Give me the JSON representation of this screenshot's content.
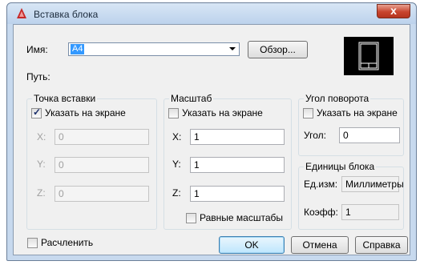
{
  "window": {
    "title": "Вставка блока",
    "close_symbol": "x"
  },
  "name_row": {
    "label": "Имя:",
    "value": "A4",
    "browse_label": "Обзор..."
  },
  "path": {
    "label": "Путь:"
  },
  "insertion_point": {
    "title": "Точка вставки",
    "specify_on_screen": {
      "label": "Указать на экране",
      "checked": true
    },
    "x": {
      "label": "X:",
      "value": "0"
    },
    "y": {
      "label": "Y:",
      "value": "0"
    },
    "z": {
      "label": "Z:",
      "value": "0"
    }
  },
  "scale": {
    "title": "Масштаб",
    "specify_on_screen": {
      "label": "Указать на экране",
      "checked": false
    },
    "x": {
      "label": "X:",
      "value": "1"
    },
    "y": {
      "label": "Y:",
      "value": "1"
    },
    "z": {
      "label": "Z:",
      "value": "1"
    },
    "uniform": {
      "label": "Равные масштабы",
      "checked": false
    }
  },
  "rotation": {
    "title": "Угол поворота",
    "specify_on_screen": {
      "label": "Указать на экране",
      "checked": false
    },
    "angle": {
      "label": "Угол:",
      "value": "0"
    }
  },
  "block_units": {
    "title": "Единицы блока",
    "unit": {
      "label": "Ед.изм:",
      "value": "Миллиметры"
    },
    "factor": {
      "label": "Коэфф:",
      "value": "1"
    }
  },
  "explode": {
    "label": "Расчленить",
    "checked": false
  },
  "buttons": {
    "ok": "OK",
    "cancel": "Отмена",
    "help": "Справка"
  },
  "colors": {
    "selection": "#3399ff",
    "title_bar": "#c7d9ee",
    "close_button": "#c8452e"
  }
}
